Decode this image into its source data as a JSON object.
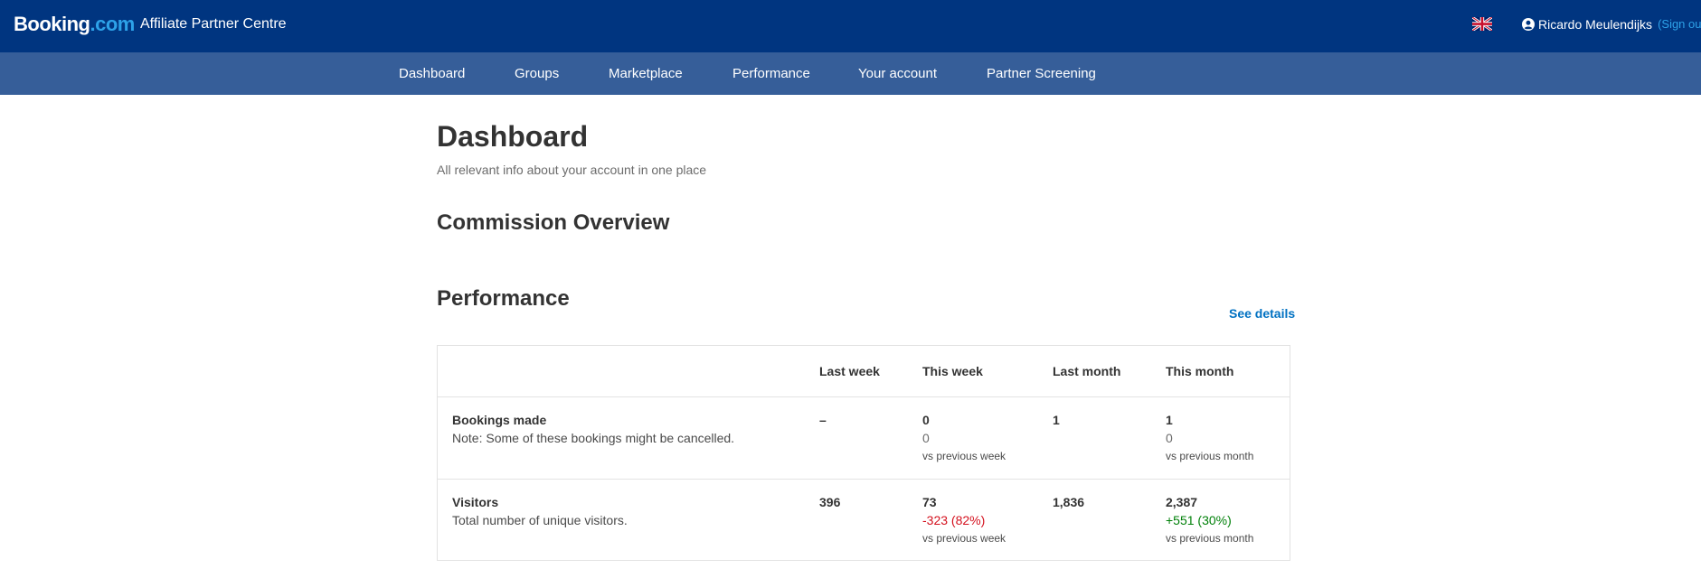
{
  "header": {
    "logo_primary": "Booking",
    "logo_secondary": ".com",
    "app_title": "Affiliate Partner Centre",
    "language_icon": "uk-flag-icon",
    "user_name": "Ricardo Meulendijks",
    "signout_label": "(Sign out)"
  },
  "nav": {
    "items": [
      {
        "label": "Dashboard"
      },
      {
        "label": "Groups"
      },
      {
        "label": "Marketplace"
      },
      {
        "label": "Performance"
      },
      {
        "label": "Your account"
      },
      {
        "label": "Partner Screening"
      }
    ]
  },
  "page": {
    "title": "Dashboard",
    "subtitle": "All relevant info about your account in one place"
  },
  "sections": {
    "commission_title": "Commission Overview",
    "performance_title": "Performance",
    "see_details_label": "See details"
  },
  "performance_table": {
    "columns": [
      "Last week",
      "This week",
      "Last month",
      "This month"
    ],
    "rows": [
      {
        "label": "Bookings made",
        "note": "Note: Some of these bookings might be cancelled.",
        "last_week": "–",
        "this_week": "0",
        "this_week_change": "0",
        "this_week_caption": "vs previous week",
        "last_month": "1",
        "this_month": "1",
        "this_month_change": "0",
        "this_month_caption": "vs previous month"
      },
      {
        "label": "Visitors",
        "note": "Total number of unique visitors.",
        "last_week": "396",
        "this_week": "73",
        "this_week_change": "-323 (82%)",
        "this_week_caption": "vs previous week",
        "last_month": "1,836",
        "this_month": "2,387",
        "this_month_change": "+551 (30%)",
        "this_month_caption": "vs previous month"
      }
    ]
  },
  "colors": {
    "header_bg": "#003580",
    "nav_bg": "#365e99",
    "link": "#0071c2",
    "negative": "#d4111e",
    "positive": "#008009"
  }
}
